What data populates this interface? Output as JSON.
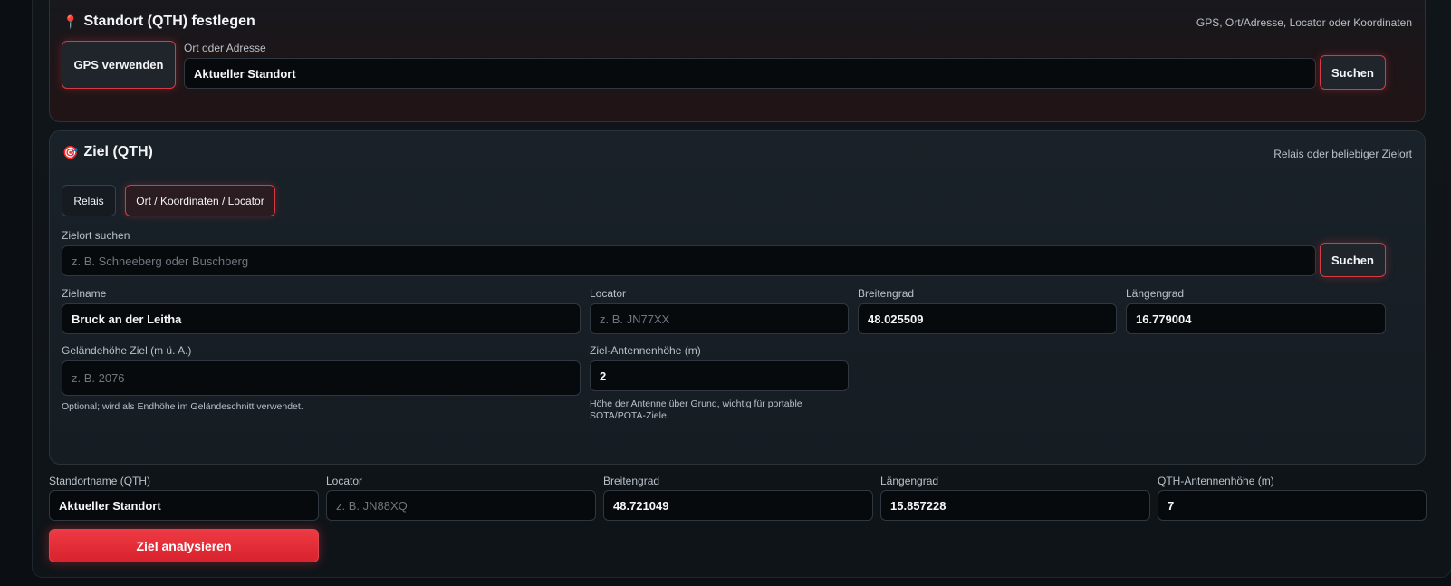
{
  "qth_card": {
    "icon": "📍",
    "title": "Standort (QTH) festlegen",
    "hint": "GPS, Ort/Adresse, Locator oder Koordinaten",
    "gps_button": "GPS verwenden",
    "address_label": "Ort oder Adresse",
    "address_value": "Aktueller Standort",
    "search_button": "Suchen"
  },
  "target_card": {
    "icon": "🎯",
    "title": "Ziel (QTH)",
    "hint": "Relais oder beliebiger Zielort",
    "tabs": [
      {
        "label": "Relais",
        "active": false
      },
      {
        "label": "Ort / Koordinaten / Locator",
        "active": true
      }
    ],
    "search_label": "Zielort suchen",
    "search_placeholder": "z. B. Schneeberg oder Buschberg",
    "search_button": "Suchen",
    "name_label": "Zielname",
    "name_value": "Bruck an der Leitha",
    "locator_label": "Locator",
    "locator_placeholder": "z. B. JN77XX",
    "lat_label": "Breitengrad",
    "lat_value": "48.025509",
    "lon_label": "Längengrad",
    "lon_value": "16.779004",
    "elevation_label": "Geländehöhe Ziel (m ü. A.)",
    "elevation_placeholder": "z. B. 2076",
    "elevation_help": "Optional; wird als Endhöhe im Geländeschnitt verwendet.",
    "antenna_label": "Ziel-Antennenhöhe (m)",
    "antenna_value": "2",
    "antenna_help_line1": "Höhe der Antenne über Grund, wichtig für portable",
    "antenna_help_line2": "SOTA/POTA-Ziele."
  },
  "qth_fields": {
    "name_label": "Standortname (QTH)",
    "name_value": "Aktueller Standort",
    "locator_label": "Locator",
    "locator_placeholder": "z. B. JN88XQ",
    "lat_label": "Breitengrad",
    "lat_value": "48.721049",
    "lon_label": "Längengrad",
    "lon_value": "15.857228",
    "antenna_label": "QTH-Antennenhöhe (m)",
    "antenna_value": "7"
  },
  "analyze_button": "Ziel analysieren",
  "colors": {
    "accent": "#ee3a43",
    "background": "#0b0e12"
  }
}
